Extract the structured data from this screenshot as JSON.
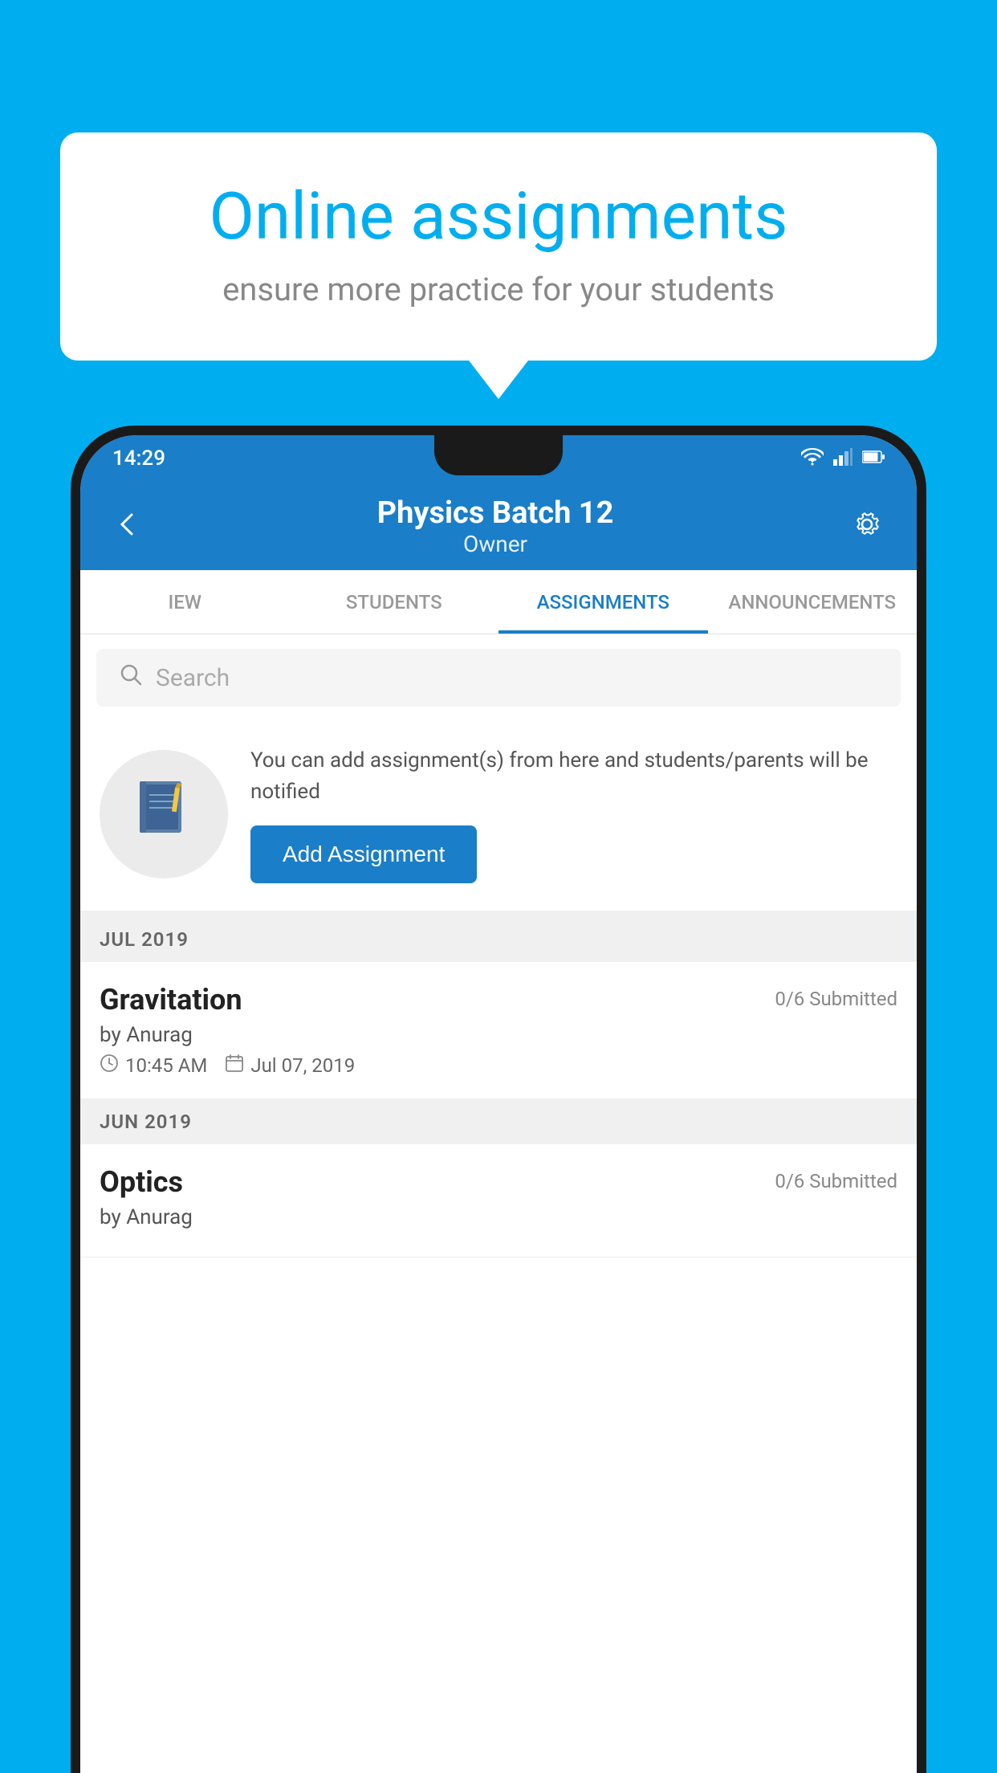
{
  "background": {
    "color": "#00AEEF"
  },
  "speech_bubble": {
    "title": "Online assignments",
    "subtitle": "ensure more practice for your students"
  },
  "status_bar": {
    "time": "14:29",
    "wifi": "▾",
    "signal": "▲",
    "battery": "▮"
  },
  "app_bar": {
    "title": "Physics Batch 12",
    "subtitle": "Owner",
    "back_icon": "←",
    "settings_icon": "⚙"
  },
  "tabs": [
    {
      "label": "IEW",
      "active": false
    },
    {
      "label": "STUDENTS",
      "active": false
    },
    {
      "label": "ASSIGNMENTS",
      "active": true
    },
    {
      "label": "ANNOUNCEMENTS",
      "active": false
    }
  ],
  "search": {
    "placeholder": "Search"
  },
  "promo": {
    "description": "You can add assignment(s) from here and students/parents will be notified",
    "button_label": "Add Assignment"
  },
  "sections": [
    {
      "month": "JUL 2019",
      "assignments": [
        {
          "name": "Gravitation",
          "submitted": "0/6 Submitted",
          "by": "by Anurag",
          "time": "10:45 AM",
          "date": "Jul 07, 2019"
        }
      ]
    },
    {
      "month": "JUN 2019",
      "assignments": [
        {
          "name": "Optics",
          "submitted": "0/6 Submitted",
          "by": "by Anurag",
          "time": "",
          "date": ""
        }
      ]
    }
  ]
}
